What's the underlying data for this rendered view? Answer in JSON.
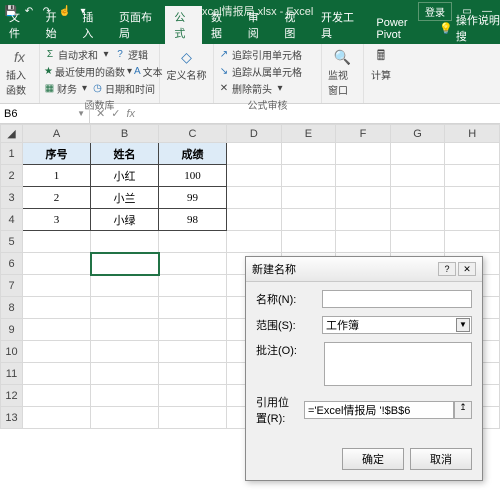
{
  "titlebar": {
    "doc": "Excel情报局.xlsx - Excel",
    "login": "登录"
  },
  "tabs": {
    "file": "文件",
    "home": "开始",
    "insert": "插入",
    "layout": "页面布局",
    "formulas": "公式",
    "data": "数据",
    "review": "审阅",
    "view": "视图",
    "dev": "开发工具",
    "powerpivot": "Power Pivot",
    "tell": "操作说明搜"
  },
  "ribbon": {
    "insert_fn": "插入函数",
    "autosum": "自动求和",
    "recent": "最近使用的函数",
    "financial": "财务",
    "logical": "逻辑",
    "text": "文本",
    "datetime": "日期和时间",
    "fnlib_label": "函数库",
    "define_name": "定义名称",
    "trace_prec": "追踪引用单元格",
    "trace_dep": "追踪从属单元格",
    "remove_arrows": "删除箭头",
    "audit_label": "公式审核",
    "watch": "监视窗口",
    "calc": "计算"
  },
  "namebox": {
    "ref": "B6"
  },
  "sheet": {
    "cols": [
      "A",
      "B",
      "C",
      "D",
      "E",
      "F",
      "G",
      "H"
    ],
    "headers": {
      "a": "序号",
      "b": "姓名",
      "c": "成绩"
    },
    "r1": {
      "a": "1",
      "b": "小红",
      "c": "100"
    },
    "r2": {
      "a": "2",
      "b": "小兰",
      "c": "99"
    },
    "r3": {
      "a": "3",
      "b": "小绿",
      "c": "98"
    }
  },
  "dialog": {
    "title": "新建名称",
    "name_lbl": "名称(N):",
    "scope_lbl": "范围(S):",
    "scope_val": "工作簿",
    "comment_lbl": "批注(O):",
    "refers_lbl": "引用位置(R):",
    "refers_val": "='Excel情报局 '!$B$6",
    "ok": "确定",
    "cancel": "取消"
  }
}
